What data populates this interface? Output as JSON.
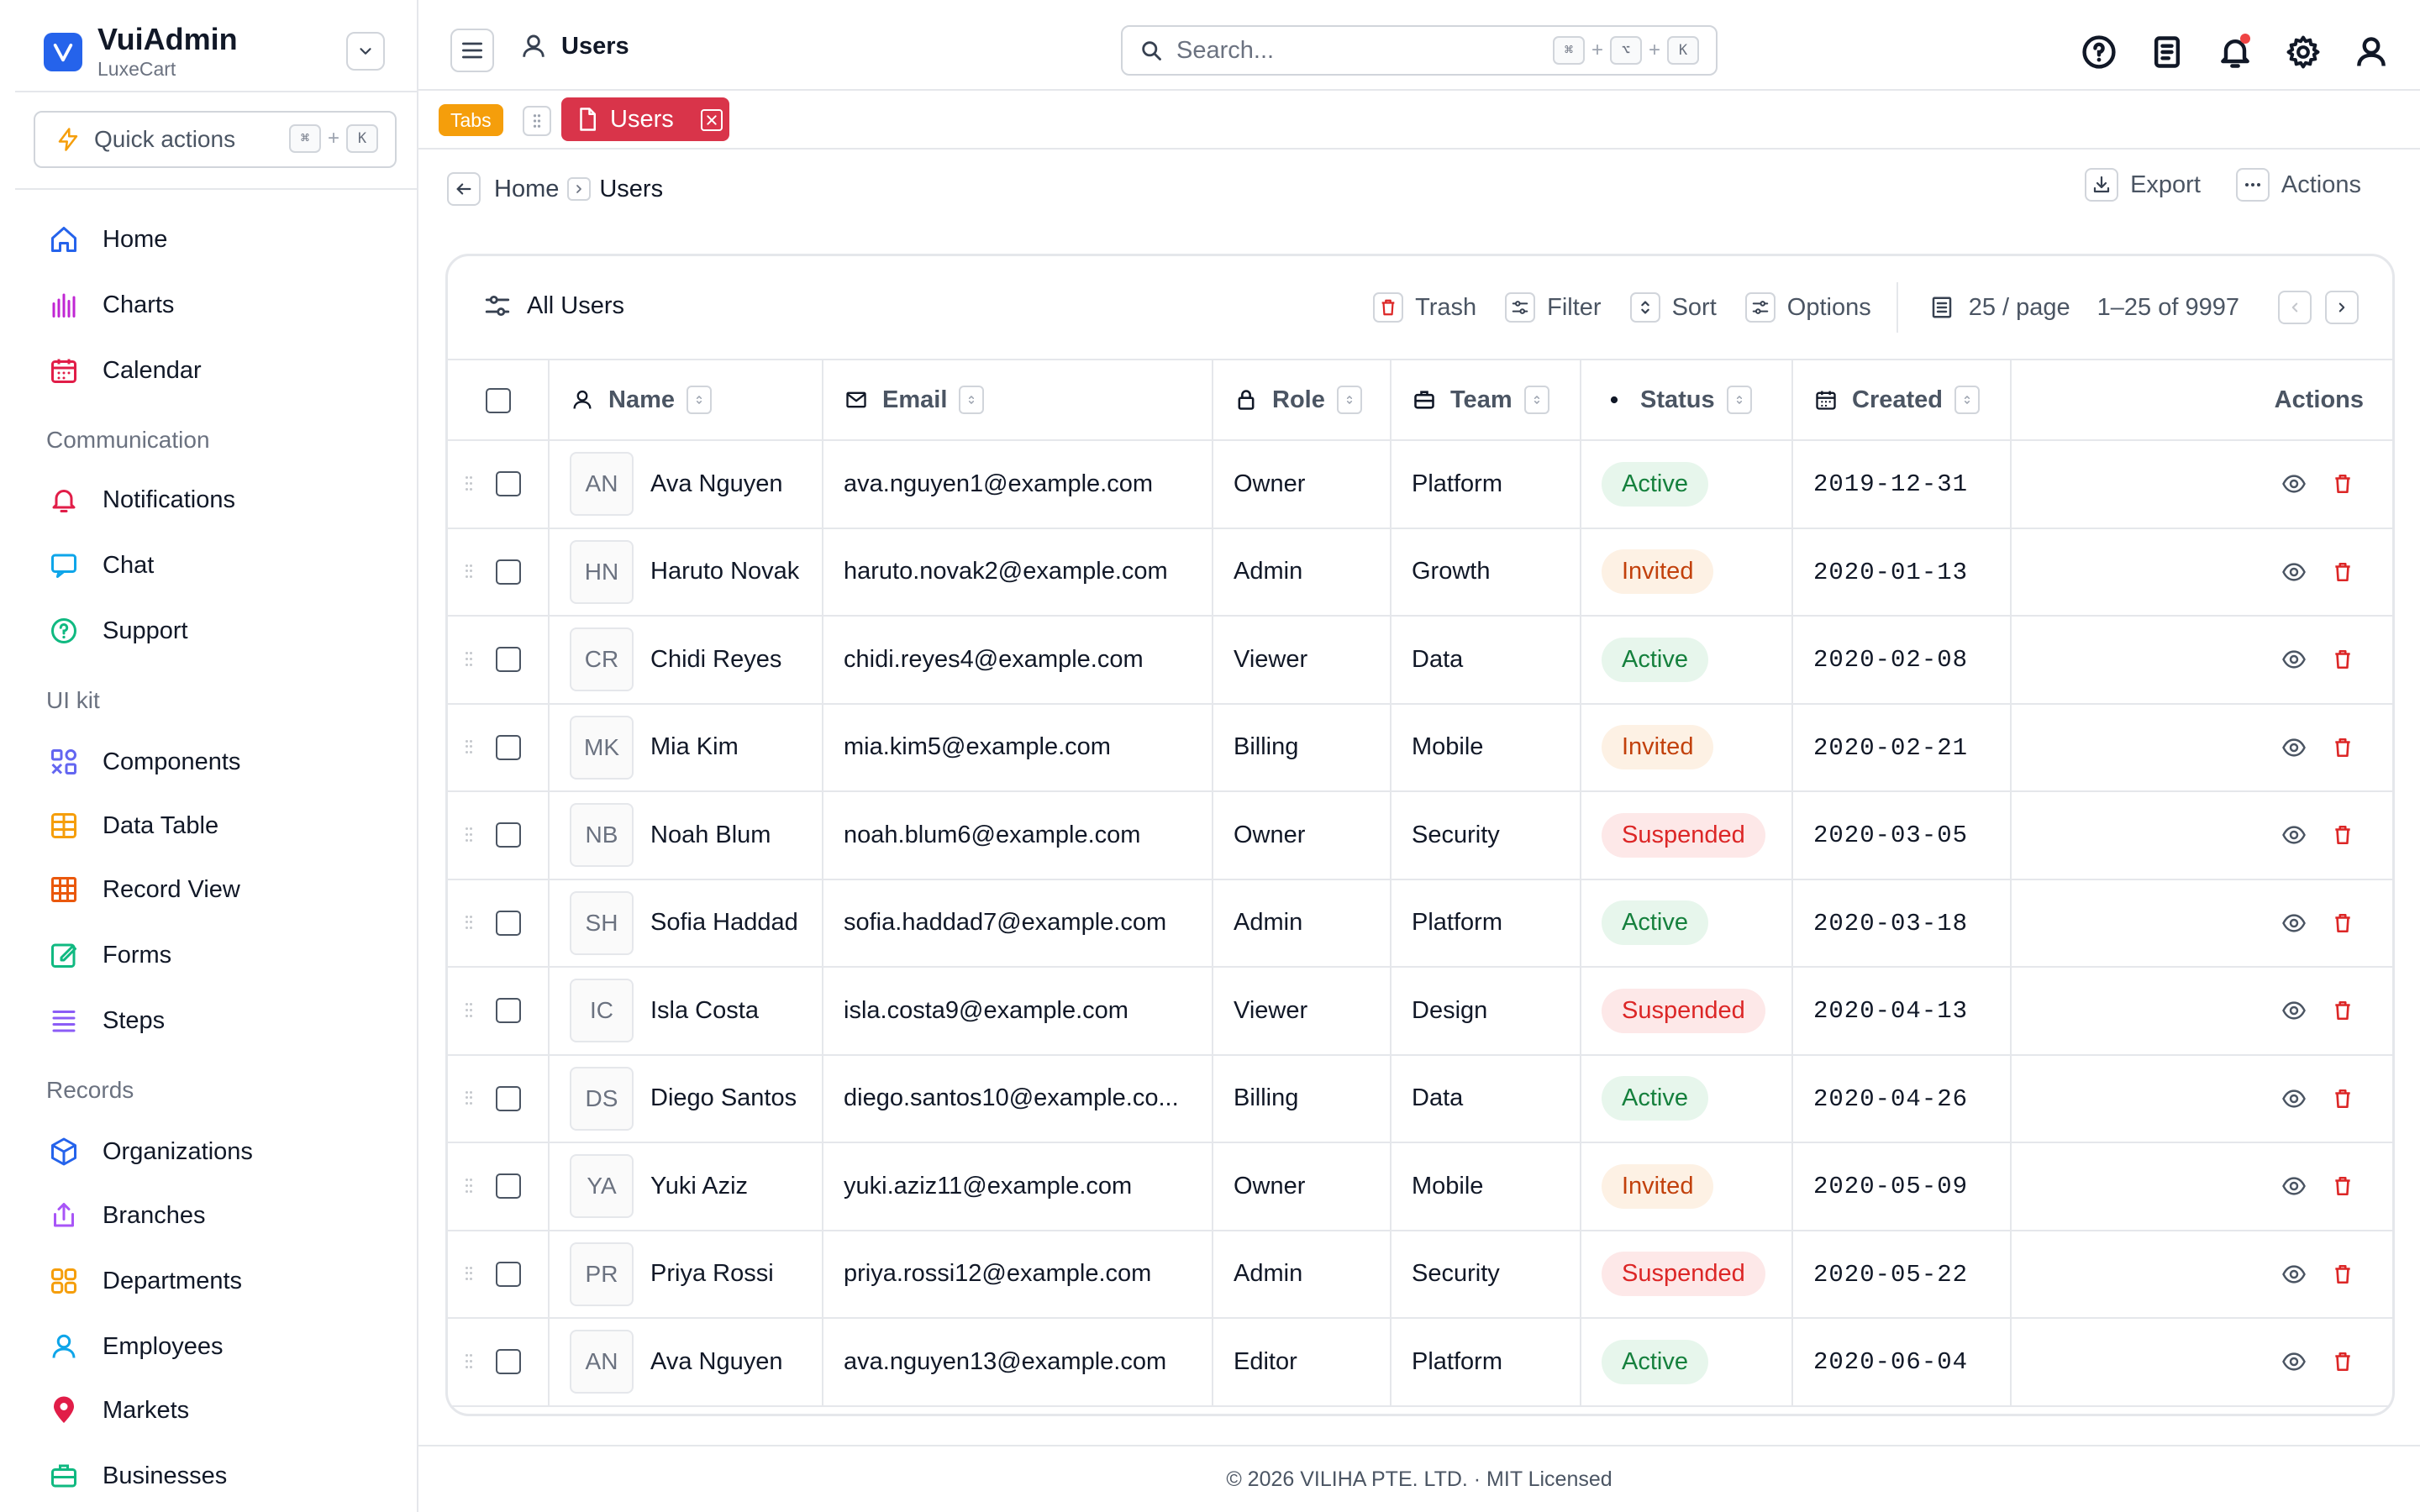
{
  "brand": {
    "name": "VuiAdmin",
    "subtitle": "LuxeCart"
  },
  "quick_actions": {
    "label": "Quick actions",
    "keys": [
      "⌘",
      "K"
    ],
    "plus": "+"
  },
  "sidebar": {
    "items_top": [
      {
        "label": "Home",
        "icon": "home-icon"
      },
      {
        "label": "Charts",
        "icon": "bar-chart-icon"
      },
      {
        "label": "Calendar",
        "icon": "calendar-icon"
      }
    ],
    "sections": [
      {
        "title": "Communication",
        "items": [
          {
            "label": "Notifications",
            "icon": "bell-icon"
          },
          {
            "label": "Chat",
            "icon": "chat-icon"
          },
          {
            "label": "Support",
            "icon": "help-circle-icon"
          }
        ]
      },
      {
        "title": "UI kit",
        "items": [
          {
            "label": "Components",
            "icon": "components-icon"
          },
          {
            "label": "Data Table",
            "icon": "table-icon"
          },
          {
            "label": "Record View",
            "icon": "grid-icon"
          },
          {
            "label": "Forms",
            "icon": "edit-icon"
          },
          {
            "label": "Steps",
            "icon": "list-icon"
          }
        ]
      },
      {
        "title": "Records",
        "items": [
          {
            "label": "Organizations",
            "icon": "cube-icon"
          },
          {
            "label": "Branches",
            "icon": "share-icon"
          },
          {
            "label": "Departments",
            "icon": "apps-icon"
          },
          {
            "label": "Employees",
            "icon": "user-icon"
          },
          {
            "label": "Markets",
            "icon": "map-pin-icon"
          },
          {
            "label": "Businesses",
            "icon": "briefcase-icon"
          }
        ]
      }
    ]
  },
  "topbar": {
    "title": "Users",
    "search": {
      "placeholder": "Search...",
      "keys": [
        "⌘",
        "⌥",
        "K"
      ],
      "plus": "+"
    }
  },
  "tabs": {
    "badge": "Tabs",
    "active_tab": "Users"
  },
  "breadcrumb": {
    "home": "Home",
    "current": "Users"
  },
  "page_actions": {
    "export": "Export",
    "actions": "Actions"
  },
  "card": {
    "title": "All Users",
    "toolbar": {
      "trash": "Trash",
      "filter": "Filter",
      "sort": "Sort",
      "options": "Options"
    },
    "pager": {
      "per_page": "25 / page",
      "range": "1–25 of 9997"
    }
  },
  "table": {
    "columns": {
      "name": "Name",
      "email": "Email",
      "role": "Role",
      "team": "Team",
      "status": "Status",
      "created": "Created",
      "actions": "Actions"
    },
    "rows": [
      {
        "initials": "AN",
        "name": "Ava Nguyen",
        "email": "ava.nguyen1@example.com",
        "role": "Owner",
        "team": "Platform",
        "status": "Active",
        "created": "2019-12-31"
      },
      {
        "initials": "HN",
        "name": "Haruto Novak",
        "email": "haruto.novak2@example.com",
        "role": "Admin",
        "team": "Growth",
        "status": "Invited",
        "created": "2020-01-13"
      },
      {
        "initials": "CR",
        "name": "Chidi Reyes",
        "email": "chidi.reyes4@example.com",
        "role": "Viewer",
        "team": "Data",
        "status": "Active",
        "created": "2020-02-08"
      },
      {
        "initials": "MK",
        "name": "Mia Kim",
        "email": "mia.kim5@example.com",
        "role": "Billing",
        "team": "Mobile",
        "status": "Invited",
        "created": "2020-02-21"
      },
      {
        "initials": "NB",
        "name": "Noah Blum",
        "email": "noah.blum6@example.com",
        "role": "Owner",
        "team": "Security",
        "status": "Suspended",
        "created": "2020-03-05"
      },
      {
        "initials": "SH",
        "name": "Sofia Haddad",
        "email": "sofia.haddad7@example.com",
        "role": "Admin",
        "team": "Platform",
        "status": "Active",
        "created": "2020-03-18"
      },
      {
        "initials": "IC",
        "name": "Isla Costa",
        "email": "isla.costa9@example.com",
        "role": "Viewer",
        "team": "Design",
        "status": "Suspended",
        "created": "2020-04-13"
      },
      {
        "initials": "DS",
        "name": "Diego Santos",
        "email": "diego.santos10@example.co...",
        "role": "Billing",
        "team": "Data",
        "status": "Active",
        "created": "2020-04-26"
      },
      {
        "initials": "YA",
        "name": "Yuki Aziz",
        "email": "yuki.aziz11@example.com",
        "role": "Owner",
        "team": "Mobile",
        "status": "Invited",
        "created": "2020-05-09"
      },
      {
        "initials": "PR",
        "name": "Priya Rossi",
        "email": "priya.rossi12@example.com",
        "role": "Admin",
        "team": "Security",
        "status": "Suspended",
        "created": "2020-05-22"
      },
      {
        "initials": "AN",
        "name": "Ava Nguyen",
        "email": "ava.nguyen13@example.com",
        "role": "Editor",
        "team": "Platform",
        "status": "Active",
        "created": "2020-06-04"
      }
    ]
  },
  "footer": {
    "text": "© 2026 VILIHA PTE. LTD. · MIT Licensed"
  },
  "colors": {
    "brand": "#2563eb",
    "active_tab": "#d9344a",
    "tabs_badge": "#f59e0b",
    "danger": "#dc2626",
    "success": "#15803d",
    "warning": "#c2410c"
  }
}
